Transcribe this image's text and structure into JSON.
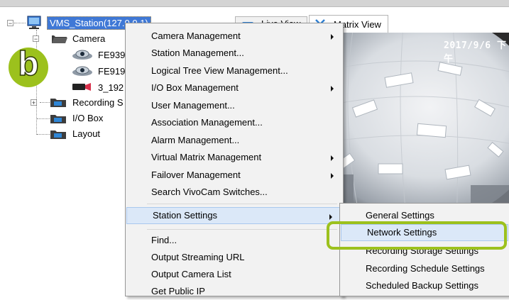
{
  "tree": {
    "station": "VMS_Station(127.0.0.1)",
    "camera_folder": "Camera",
    "cameras": [
      "FE939",
      "FE919",
      "3_192"
    ],
    "recording": "Recording S",
    "io_box": "I/O Box",
    "layout": "Layout"
  },
  "tabs": {
    "live_view": "Live View",
    "matrix_view": "Matrix View"
  },
  "video": {
    "timestamp": "2017/9/6 下午"
  },
  "badge": {
    "letter": "b"
  },
  "context_menu": {
    "items": [
      {
        "label": "Camera Management",
        "submenu": true
      },
      {
        "label": "Station Management...",
        "submenu": false
      },
      {
        "label": "Logical Tree View Management...",
        "submenu": false
      },
      {
        "label": "I/O Box Management",
        "submenu": true
      },
      {
        "label": "User Management...",
        "submenu": false
      },
      {
        "label": "Association Management...",
        "submenu": false
      },
      {
        "label": "Alarm Management...",
        "submenu": false
      },
      {
        "label": "Virtual Matrix Management",
        "submenu": true
      },
      {
        "label": "Failover Management",
        "submenu": true
      },
      {
        "label": "Search VivoCam Switches...",
        "submenu": false
      },
      {
        "label": "Station Settings",
        "submenu": true
      },
      {
        "label": "Find...",
        "submenu": false
      },
      {
        "label": "Output Streaming URL",
        "submenu": false
      },
      {
        "label": "Output Camera List",
        "submenu": false
      },
      {
        "label": "Get Public IP",
        "submenu": false
      }
    ]
  },
  "submenu": {
    "items": [
      {
        "label": "General Settings"
      },
      {
        "label": "Network Settings"
      },
      {
        "label": "Recording Storage Settings"
      },
      {
        "label": "Recording Schedule Settings"
      },
      {
        "label": "Scheduled Backup Settings"
      }
    ]
  },
  "colors": {
    "accent": "#9cc11d",
    "selection": "#3f78d6",
    "menu_highlight": "#dbe8f8"
  }
}
